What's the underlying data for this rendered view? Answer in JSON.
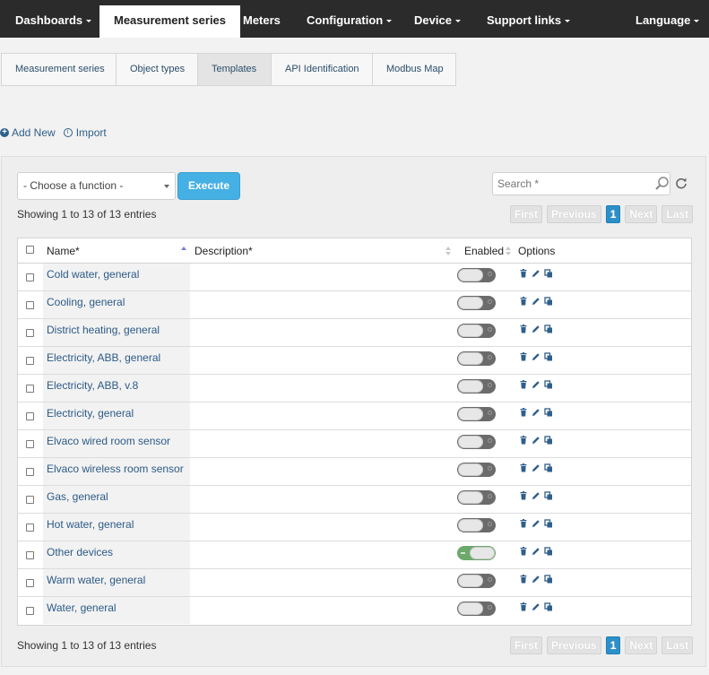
{
  "topnav": {
    "items": [
      {
        "label": "Dashboards",
        "caret": true
      },
      {
        "label": "Measurement series",
        "caret": false,
        "active": true
      },
      {
        "label": "Meters",
        "caret": false
      },
      {
        "label": "Configuration",
        "caret": true
      },
      {
        "label": "Device",
        "caret": true
      },
      {
        "label": "Support links",
        "caret": true
      },
      {
        "label": "Language",
        "caret": true
      }
    ]
  },
  "subtabs": [
    "Measurement series",
    "Object types",
    "Templates",
    "API Identification",
    "Modbus Map"
  ],
  "actions": {
    "add_new": "Add New",
    "import": "Import"
  },
  "toolbar": {
    "function_select": "- Choose a function -",
    "execute": "Execute",
    "search_placeholder": "Search *"
  },
  "info_text": "Showing 1 to 13 of 13 entries",
  "pager": {
    "first": "First",
    "previous": "Previous",
    "current": "1",
    "next": "Next",
    "last": "Last"
  },
  "table": {
    "headers": {
      "name": "Name*",
      "description": "Description*",
      "enabled": "Enabled",
      "options": "Options"
    },
    "rows": [
      {
        "name": "Cold water, general",
        "enabled": false
      },
      {
        "name": "Cooling, general",
        "enabled": false
      },
      {
        "name": "District heating, general",
        "enabled": false
      },
      {
        "name": "Electricity, ABB, general",
        "enabled": false
      },
      {
        "name": "Electricity, ABB, v.8",
        "enabled": false
      },
      {
        "name": "Electricity, general",
        "enabled": false
      },
      {
        "name": "Elvaco wired room sensor",
        "enabled": false
      },
      {
        "name": "Elvaco wireless room sensor",
        "enabled": false
      },
      {
        "name": "Gas, general",
        "enabled": false
      },
      {
        "name": "Hot water, general",
        "enabled": false
      },
      {
        "name": "Other devices",
        "enabled": true
      },
      {
        "name": "Warm water, general",
        "enabled": false
      },
      {
        "name": "Water, general",
        "enabled": false
      }
    ]
  },
  "colors": {
    "nav_bg": "#2b2b2b",
    "link": "#2c5a86",
    "execute": "#45b0e4",
    "toggle_on": "#6da96d",
    "toggle_off": "#6b6b6b"
  }
}
